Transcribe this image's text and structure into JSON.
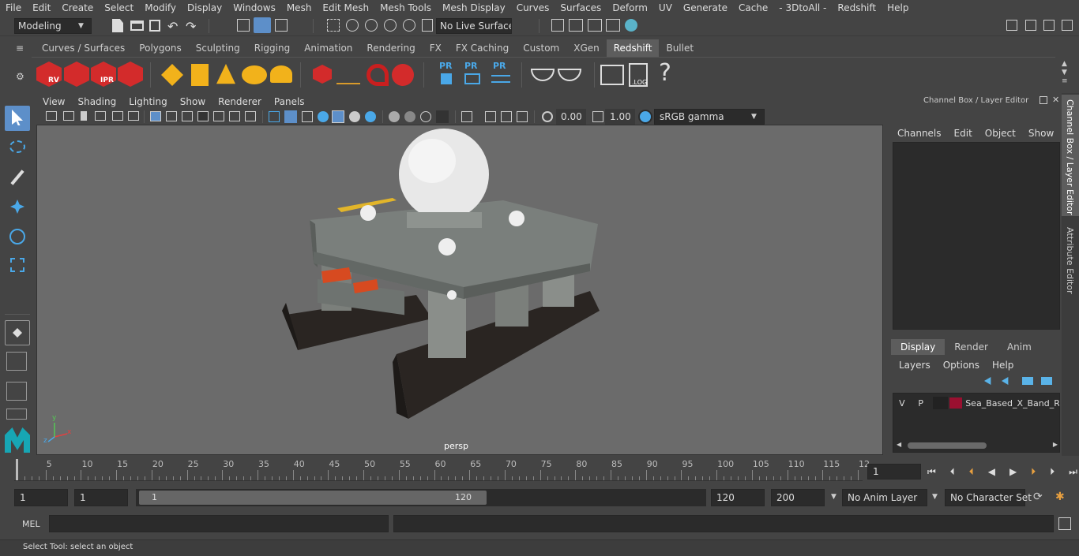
{
  "menu": [
    "File",
    "Edit",
    "Create",
    "Select",
    "Modify",
    "Display",
    "Windows",
    "Mesh",
    "Edit Mesh",
    "Mesh Tools",
    "Mesh Display",
    "Curves",
    "Surfaces",
    "Deform",
    "UV",
    "Generate",
    "Cache",
    "- 3DtoAll -",
    "Redshift",
    "Help"
  ],
  "status": {
    "mode": "Modeling",
    "live_surface": "No Live Surface"
  },
  "shelf_tabs": [
    "Curves / Surfaces",
    "Polygons",
    "Sculpting",
    "Rigging",
    "Animation",
    "Rendering",
    "FX",
    "FX Caching",
    "Custom",
    "XGen",
    "Redshift",
    "Bullet"
  ],
  "shelf_active": "Redshift",
  "shelf_labels": {
    "rv": "RV",
    "ipr": "IPR",
    "pr1": "PR",
    "pr2": "PR",
    "pr3": "PR",
    "log": ".LOG",
    "help": "?"
  },
  "panel_menu": [
    "View",
    "Shading",
    "Lighting",
    "Show",
    "Renderer",
    "Panels"
  ],
  "panel_toolbar": {
    "exposure": "0.00",
    "gamma": "1.00",
    "colorspace": "sRGB gamma"
  },
  "viewport": {
    "camera_label": "persp",
    "axis_x": "x",
    "axis_y": "y",
    "axis_z": "z"
  },
  "channel_box": {
    "title": "Channel Box / Layer Editor",
    "menus": [
      "Channels",
      "Edit",
      "Object",
      "Show"
    ]
  },
  "layer_editor": {
    "tabs": [
      "Display",
      "Render",
      "Anim"
    ],
    "active_tab": "Display",
    "menus": [
      "Layers",
      "Options",
      "Help"
    ],
    "layer": {
      "v": "V",
      "p": "P",
      "name": "Sea_Based_X_Band_Ra",
      "color": "#9a1030"
    }
  },
  "side_tabs": [
    "Channel Box / Layer Editor",
    "Attribute Editor"
  ],
  "timeline": {
    "ticks": [
      "5",
      "10",
      "15",
      "20",
      "25",
      "30",
      "35",
      "40",
      "45",
      "50",
      "55",
      "60",
      "65",
      "70",
      "75",
      "80",
      "85",
      "90",
      "95",
      "100",
      "105",
      "110",
      "115",
      "12"
    ],
    "start_label": "1",
    "current_frame": "1"
  },
  "range": {
    "start": "1",
    "playback_start": "1",
    "range_start_label": "1",
    "range_end_label": "120",
    "playback_end": "120",
    "end": "200",
    "anim_layer": "No Anim Layer",
    "character_set": "No Character Set"
  },
  "mel": {
    "label": "MEL"
  },
  "help_line": "Select Tool: select an object",
  "colors": {
    "accent": "#5d8fc9",
    "viewport_bg": "#6b6b6b",
    "panel_bg": "#444444",
    "field_bg": "#2b2b2b"
  }
}
